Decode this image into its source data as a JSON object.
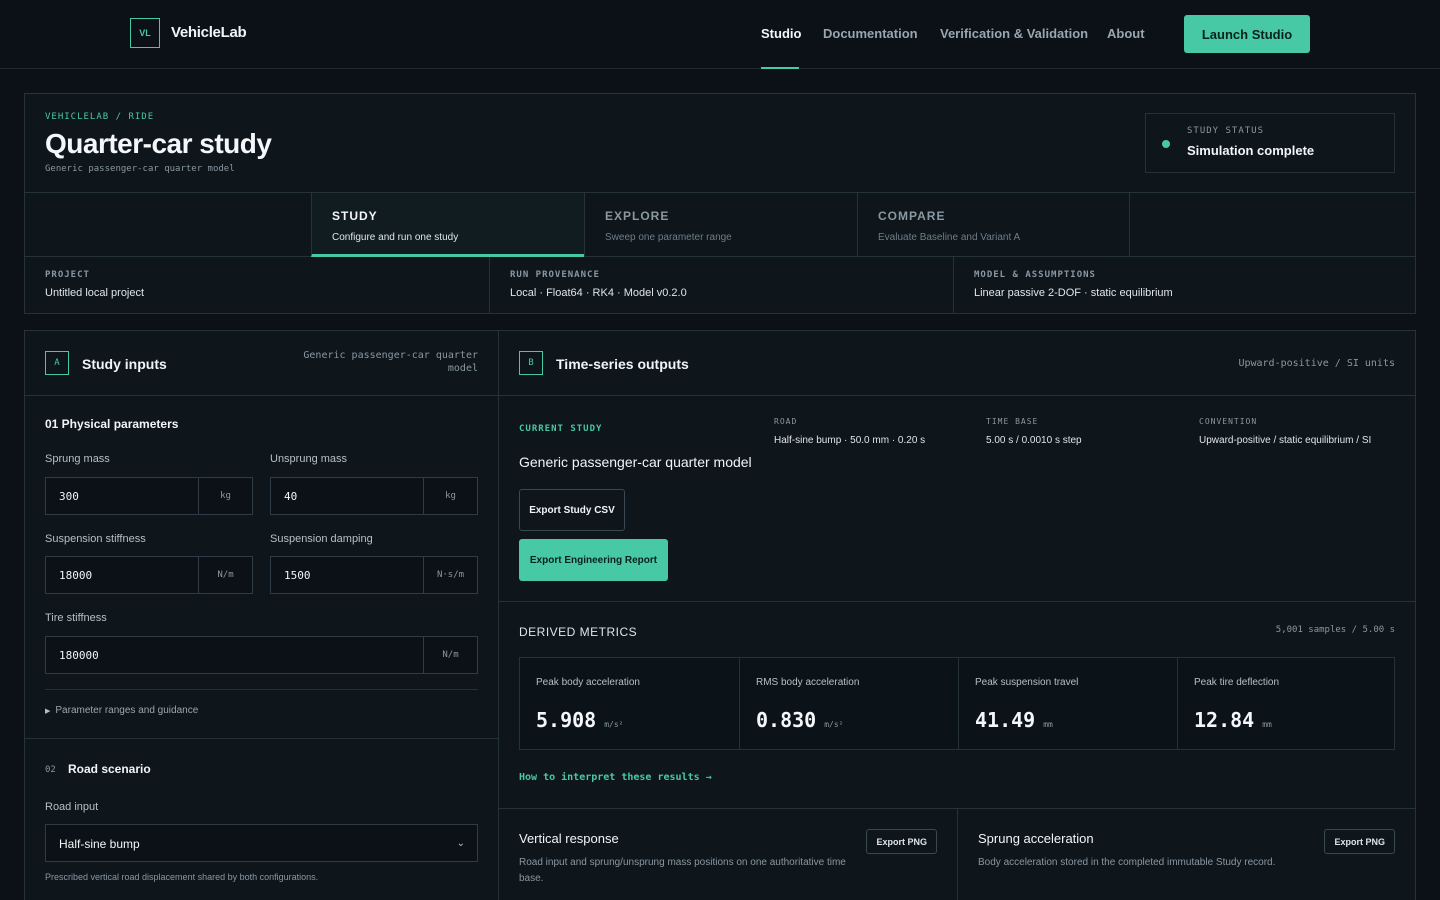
{
  "nav": {
    "logo_mark": "VL",
    "logo_text": "VehicleLab",
    "links": [
      "Studio",
      "Documentation",
      "Verification & Validation",
      "About"
    ],
    "cta": "Launch Studio"
  },
  "header": {
    "breadcrumb": "VEHICLELAB / RIDE",
    "title": "Quarter-car study",
    "subtitle": "Generic passenger-car quarter model",
    "status_label": "STUDY STATUS",
    "status_value": "Simulation complete"
  },
  "modes": [
    {
      "name": "STUDY",
      "desc": "Configure and run one study"
    },
    {
      "name": "EXPLORE",
      "desc": "Sweep one parameter range"
    },
    {
      "name": "COMPARE",
      "desc": "Evaluate Baseline and Variant A"
    }
  ],
  "provenance": [
    {
      "label": "PROJECT",
      "value": "Untitled local project"
    },
    {
      "label": "RUN PROVENANCE",
      "value": "Local · Float64 · RK4 · Model v0.2.0"
    },
    {
      "label": "MODEL & ASSUMPTIONS",
      "value": "Linear passive 2-DOF · static equilibrium"
    }
  ],
  "inputs": {
    "badge": "A",
    "title": "Study inputs",
    "meta": "Generic passenger-car quarter model",
    "section_title": "01 Physical parameters",
    "fields": [
      {
        "label": "Sprung mass",
        "value": "300",
        "unit": "kg"
      },
      {
        "label": "Unsprung mass",
        "value": "40",
        "unit": "kg"
      },
      {
        "label": "Suspension stiffness",
        "value": "18000",
        "unit": "N/m"
      },
      {
        "label": "Suspension damping",
        "value": "1500",
        "unit": "N·s/m"
      },
      {
        "label": "Tire stiffness",
        "value": "180000",
        "unit": "N/m"
      }
    ],
    "guidance": "Parameter ranges and guidance",
    "road": {
      "num": "02",
      "title": "Road scenario",
      "input_label": "Road input",
      "selected": "Half-sine bump",
      "help": "Prescribed vertical road displacement shared by both configurations."
    }
  },
  "outputs": {
    "badge": "B",
    "title": "Time-series outputs",
    "meta": "Upward-positive / SI units",
    "current_label": "CURRENT STUDY",
    "current_name": "Generic passenger-car quarter model",
    "info": [
      {
        "label": "ROAD",
        "value": "Half-sine bump · 50.0 mm · 0.20 s"
      },
      {
        "label": "TIME BASE",
        "value": "5.00 s / 0.0010 s step"
      },
      {
        "label": "CONVENTION",
        "value": "Upward-positive / static equilibrium / SI"
      }
    ],
    "export_csv": "Export Study CSV",
    "export_report": "Export Engineering Report",
    "derived_title": "DERIVED METRICS",
    "derived_meta": "5,001 samples / 5.00 s",
    "metrics": [
      {
        "label": "Peak body acceleration",
        "value": "5.908",
        "unit": "m/s²"
      },
      {
        "label": "RMS body acceleration",
        "value": "0.830",
        "unit": "m/s²"
      },
      {
        "label": "Peak suspension travel",
        "value": "41.49",
        "unit": "mm"
      },
      {
        "label": "Peak tire deflection",
        "value": "12.84",
        "unit": "mm"
      }
    ],
    "interpret_link": "How to interpret these results →",
    "plots": [
      {
        "title": "Vertical response",
        "desc": "Road input and sprung/unsprung mass positions on one authoritative time base.",
        "export": "Export PNG"
      },
      {
        "title": "Sprung acceleration",
        "desc": "Body acceleration stored in the completed immutable Study record.",
        "export": "Export PNG"
      }
    ]
  },
  "colors": {
    "accent": "#47c9a6",
    "background": "#0b1116",
    "panel": "#0e151b",
    "border": "#26323a"
  }
}
